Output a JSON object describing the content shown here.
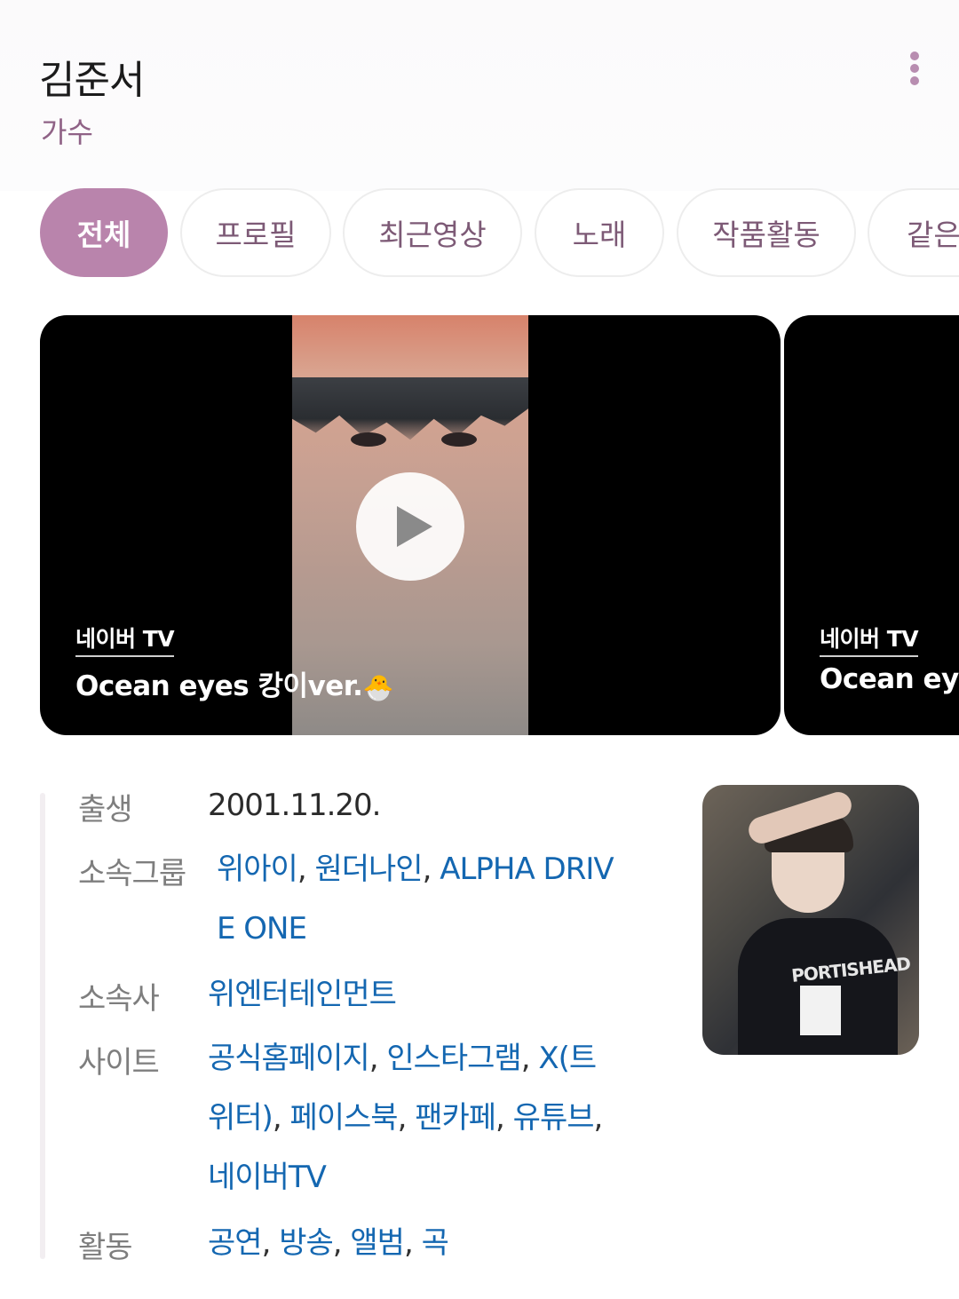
{
  "header": {
    "name": "김준서",
    "subtitle": "가수"
  },
  "tabs": [
    "전체",
    "프로필",
    "최근영상",
    "노래",
    "작품활동",
    "같은"
  ],
  "videos": [
    {
      "source": "네이버 TV",
      "title": "Ocean eyes 캉이ver."
    },
    {
      "source": "네이버 TV",
      "title": "Ocean eye"
    }
  ],
  "profile": {
    "labels": {
      "birth": "출생",
      "group": "소속그룹",
      "agency": "소속사",
      "site": "사이트",
      "activity": "활동"
    },
    "birth": "2001.11.20.",
    "groups": [
      "위아이",
      "원더나인",
      "ALPHA DRIV",
      "E ONE"
    ],
    "agency": "위엔터테인먼트",
    "sites": [
      "공식홈페이지",
      "인스타그램",
      "X(트",
      "위터)",
      "페이스북",
      "팬카페",
      "유튜브",
      "네이버TV"
    ],
    "activities": [
      "공연",
      "방송",
      "앨범",
      "곡"
    ],
    "photo_text": "PORTISHEAD"
  },
  "colors": {
    "accent": "#b984ac",
    "link": "#1467b1",
    "subtitle": "#8f6286"
  }
}
